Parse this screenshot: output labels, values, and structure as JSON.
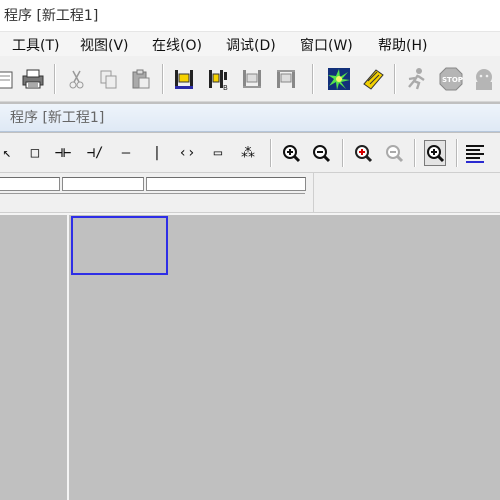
{
  "window": {
    "title": "程序 [新工程1]"
  },
  "menu": {
    "items": [
      {
        "label": "工具(T)"
      },
      {
        "label": "视图(V)"
      },
      {
        "label": "在线(O)"
      },
      {
        "label": "调试(D)"
      },
      {
        "label": "窗口(W)"
      },
      {
        "label": "帮助(H)"
      }
    ]
  },
  "document": {
    "title": "程序 [新工程1]"
  },
  "ladder_toolbar": {
    "glyphs": [
      "↖",
      "□",
      "⊣⊢",
      "⊣/⊢",
      "—",
      "|",
      "‹›",
      "▭",
      "⁂"
    ]
  }
}
